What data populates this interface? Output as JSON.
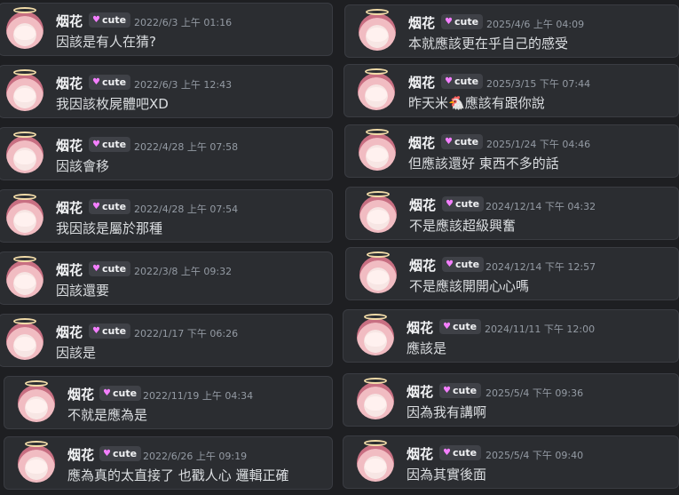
{
  "left": [
    {
      "name": "烟花",
      "badge": "cute",
      "time": "2022/6/3 上午 01:16",
      "message": "因該是有人在猜?"
    },
    {
      "name": "烟花",
      "badge": "cute",
      "time": "2022/6/3 上午 12:43",
      "message": "我因該枚屍體吧XD"
    },
    {
      "name": "烟花",
      "badge": "cute",
      "time": "2022/4/28 上午 07:58",
      "message": "因該會移"
    },
    {
      "name": "烟花",
      "badge": "cute",
      "time": "2022/4/28 上午 07:54",
      "message": "我因該是屬於那種"
    },
    {
      "name": "烟花",
      "badge": "cute",
      "time": "2022/3/8 上午 09:32",
      "message": "因該還要"
    },
    {
      "name": "烟花",
      "badge": "cute",
      "time": "2022/1/17 下午 06:26",
      "message": "因該是"
    },
    {
      "name": "烟花",
      "badge": "cute",
      "time": "2022/11/19 上午 04:34",
      "message": "不就是應為是"
    },
    {
      "name": "烟花",
      "badge": "cute",
      "time": "2022/6/26 上午 09:19",
      "message": "應為真的太直接了 也戳人心 邏輯正確"
    }
  ],
  "right": [
    {
      "name": "烟花",
      "badge": "cute",
      "time": "2025/4/6 上午 04:09",
      "message": "本就應該更在乎自己的感受"
    },
    {
      "name": "烟花",
      "badge": "cute",
      "time": "2025/3/15 下午 07:44",
      "message": "昨天米",
      "emoji": "🐔",
      "message_after": "應該有跟你說"
    },
    {
      "name": "烟花",
      "badge": "cute",
      "time": "2025/1/24 下午 04:46",
      "message": "但應該還好 東西不多的話"
    },
    {
      "name": "烟花",
      "badge": "cute",
      "time": "2024/12/14 下午 04:32",
      "message": "不是應該超級興奮"
    },
    {
      "name": "烟花",
      "badge": "cute",
      "time": "2024/12/14 下午 12:57",
      "message": "不是應該開開心心嗎"
    },
    {
      "name": "烟花",
      "badge": "cute",
      "time": "2024/11/11 下午 12:00",
      "message": "應該是"
    },
    {
      "name": "烟花",
      "badge": "cute",
      "time": "2025/5/4 下午 09:36",
      "message": "因為我有講啊"
    },
    {
      "name": "烟花",
      "badge": "cute",
      "time": "2025/5/4 下午 09:40",
      "message": "因為其實後面"
    }
  ],
  "colors": {
    "background": "#1e1f22",
    "card": "#2b2d31",
    "badge": "#3f4147",
    "heart": "#f47fff",
    "time": "#949ba4",
    "text": "#dbdee1"
  },
  "icons": {
    "badge_icon": "heart-icon",
    "avatar": "anime-avatar"
  }
}
